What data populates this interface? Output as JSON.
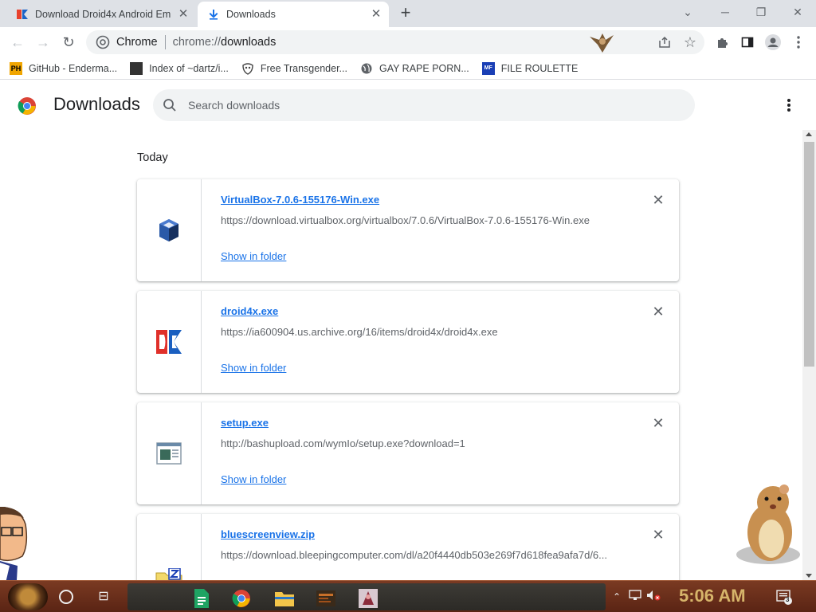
{
  "tabs": [
    {
      "title": "Download Droid4x Android Em",
      "active": false
    },
    {
      "title": "Downloads",
      "active": true
    }
  ],
  "toolbar": {
    "omnibox_chip": "Chrome",
    "url_scheme": "chrome://",
    "url_path": "downloads"
  },
  "bookmarks": [
    {
      "label": "GitHub - Enderma...",
      "icon": "ph-icon",
      "color": "#f0a500"
    },
    {
      "label": "Index of ~dartz/i...",
      "icon": "pixel-icon",
      "color": "#333333"
    },
    {
      "label": "Free Transgender...",
      "icon": "mask-icon",
      "color": "#555555"
    },
    {
      "label": "GAY RAPE PORN...",
      "icon": "globe-icon",
      "color": "#5f6368"
    },
    {
      "label": "FILE ROULETTE",
      "icon": "mf-icon",
      "color": "#1a3fb5"
    }
  ],
  "page": {
    "title": "Downloads",
    "search_placeholder": "Search downloads",
    "section": "Today"
  },
  "downloads": [
    {
      "name": "VirtualBox-7.0.6-155176-Win.exe",
      "url": "https://download.virtualbox.org/virtualbox/7.0.6/VirtualBox-7.0.6-155176-Win.exe",
      "action": "Show in folder",
      "icon": "virtualbox-icon"
    },
    {
      "name": "droid4x.exe",
      "url": "https://ia600904.us.archive.org/16/items/droid4x/droid4x.exe",
      "action": "Show in folder",
      "icon": "droid4x-icon"
    },
    {
      "name": "setup.exe",
      "url": "http://bashupload.com/wymIo/setup.exe?download=1",
      "action": "Show in folder",
      "icon": "installer-icon"
    },
    {
      "name": "bluescreenview.zip",
      "url": "https://download.bleepingcomputer.com/dl/a20f4440db503e269f7d618fea9afa7d/6...",
      "action": "",
      "icon": "zip-icon"
    }
  ],
  "taskbar": {
    "clock": "5:06 AM",
    "notifications": "3"
  },
  "colors": {
    "link": "#1a73e8",
    "tabstrip": "#dee1e6",
    "omnibox": "#f1f3f4"
  }
}
